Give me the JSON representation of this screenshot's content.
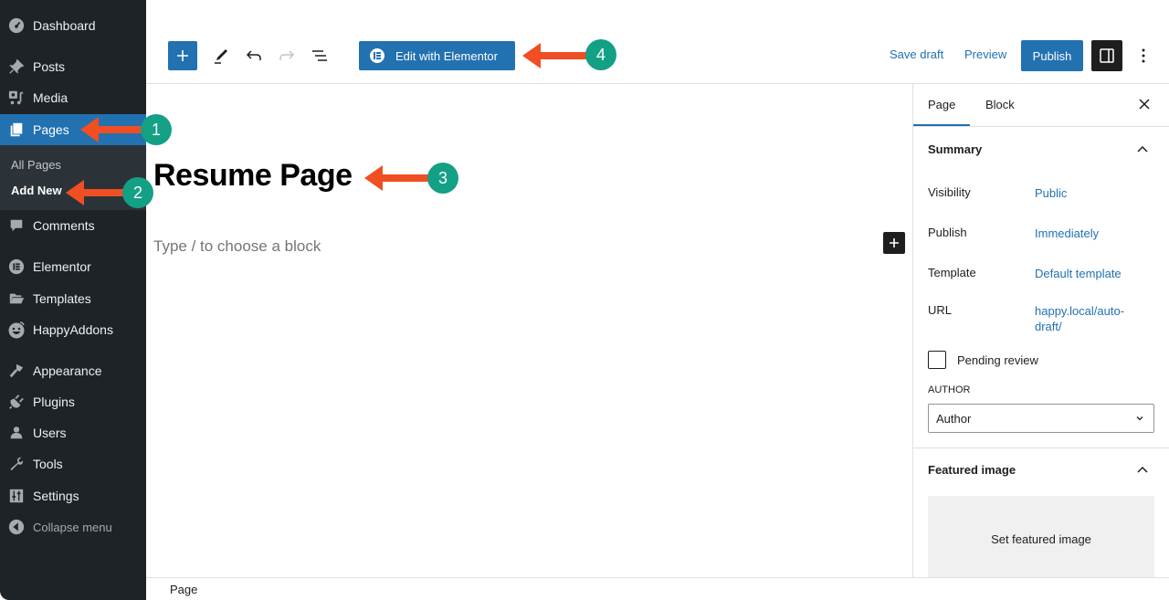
{
  "sidebar": {
    "items": [
      {
        "label": "Dashboard",
        "icon": "dashboard-icon"
      },
      {
        "label": "Posts",
        "icon": "pin-icon"
      },
      {
        "label": "Media",
        "icon": "media-icon"
      },
      {
        "label": "Pages",
        "icon": "pages-icon",
        "active": true
      },
      {
        "label": "Comments",
        "icon": "comment-icon"
      },
      {
        "label": "Elementor",
        "icon": "elementor-icon"
      },
      {
        "label": "Templates",
        "icon": "folder-icon"
      },
      {
        "label": "HappyAddons",
        "icon": "happy-face-icon"
      },
      {
        "label": "Appearance",
        "icon": "paintbrush-icon"
      },
      {
        "label": "Plugins",
        "icon": "plug-icon"
      },
      {
        "label": "Users",
        "icon": "user-icon"
      },
      {
        "label": "Tools",
        "icon": "wrench-icon"
      },
      {
        "label": "Settings",
        "icon": "sliders-icon"
      },
      {
        "label": "Collapse menu",
        "icon": "collapse-arrow-icon"
      }
    ],
    "submenu": [
      {
        "label": "All Pages"
      },
      {
        "label": "Add New",
        "current": true
      }
    ]
  },
  "toolbar": {
    "inserter_icon": "plus-icon",
    "tools_icon": "pencil-icon",
    "undo_icon": "undo-icon",
    "redo_icon": "redo-icon",
    "list_view_icon": "list-view-icon",
    "elementor_label": "Edit with Elementor",
    "save_draft_label": "Save draft",
    "preview_label": "Preview",
    "publish_label": "Publish",
    "settings_icon": "sidebar-toggle-icon",
    "options_icon": "kebab-menu-icon"
  },
  "editor": {
    "title": "Resume Page",
    "block_placeholder": "Type / to choose a block"
  },
  "inspector": {
    "tabs": [
      {
        "label": "Page",
        "active": true
      },
      {
        "label": "Block"
      }
    ],
    "summary": {
      "title": "Summary",
      "rows": [
        {
          "label": "Visibility",
          "value": "Public"
        },
        {
          "label": "Publish",
          "value": "Immediately"
        },
        {
          "label": "Template",
          "value": "Default template"
        },
        {
          "label": "URL",
          "value": "happy.local/auto-draft/"
        }
      ],
      "pending_review_label": "Pending review",
      "pending_review_checked": false,
      "author_label": "AUTHOR",
      "author_value": "Author"
    },
    "featured_image": {
      "title": "Featured image",
      "set_label": "Set featured image"
    }
  },
  "footer": {
    "breadcrumb": "Page"
  },
  "annotations": [
    {
      "number": "1",
      "target": "Pages menu item"
    },
    {
      "number": "2",
      "target": "Add New submenu"
    },
    {
      "number": "3",
      "target": "Page title"
    },
    {
      "number": "4",
      "target": "Edit with Elementor button"
    }
  ],
  "colors": {
    "accent": "#2271b1",
    "sidebar_bg": "#1d2327",
    "submenu_bg": "#2c3338",
    "annotation_arrow": "#f04e23",
    "annotation_badge": "#14a085"
  }
}
